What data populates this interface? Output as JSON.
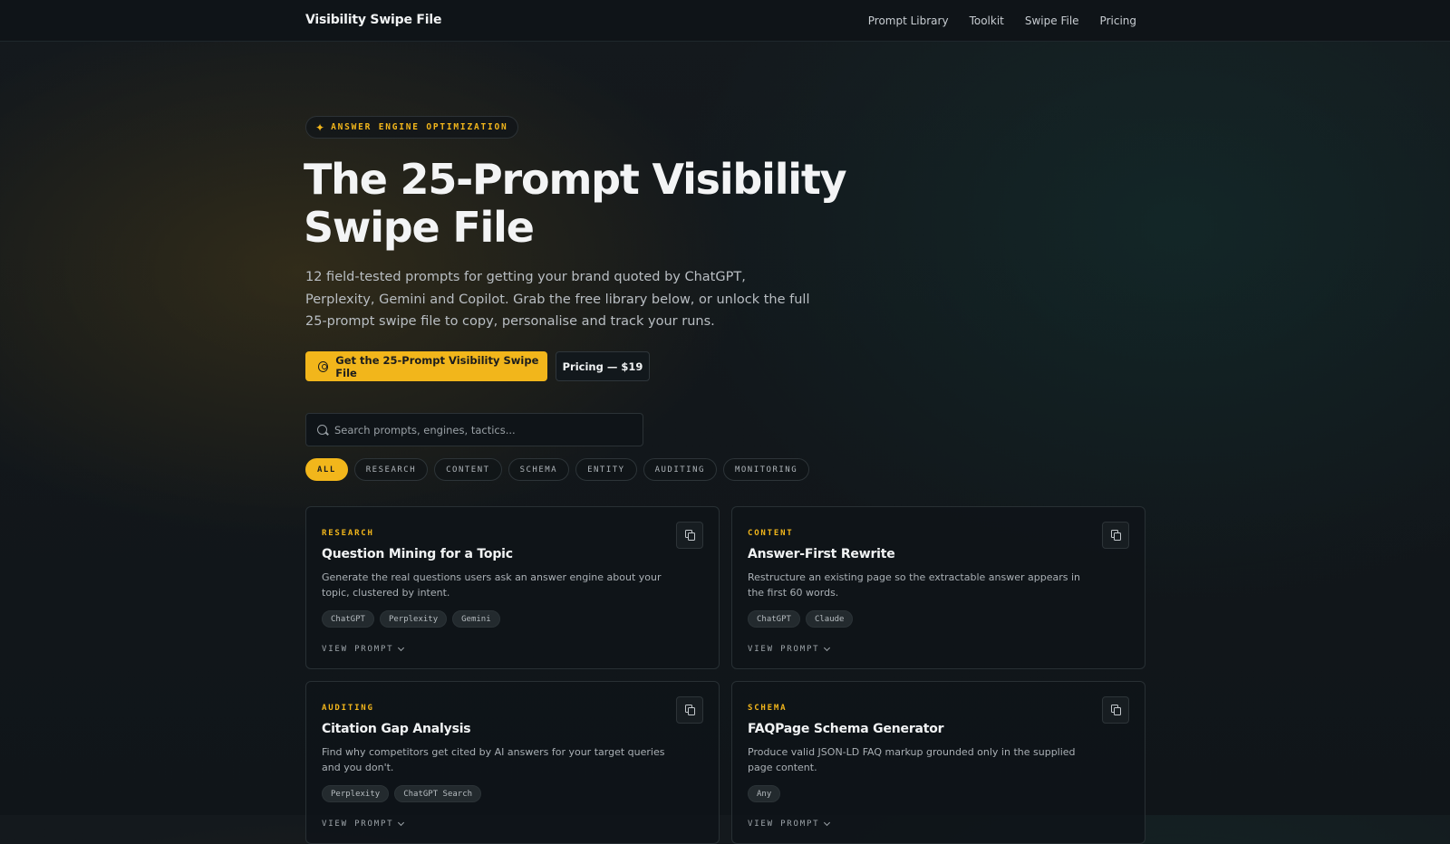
{
  "nav": {
    "brand": "Visibility Swipe File",
    "links": [
      "Prompt Library",
      "Toolkit",
      "Swipe File",
      "Pricing"
    ]
  },
  "hero": {
    "eyebrow": "ANSWER ENGINE OPTIMIZATION",
    "title": "The 25-Prompt Visibility Swipe File",
    "subtitle": "12 field-tested prompts for getting your brand quoted by ChatGPT, Perplexity, Gemini and Copilot. Grab the free library below, or unlock the full 25-prompt swipe file to copy, personalise and track your runs.",
    "primary_button": "Get the 25-Prompt Visibility Swipe File",
    "secondary_button": "Pricing — $19"
  },
  "search": {
    "placeholder": "Search prompts, engines, tactics..."
  },
  "filters": {
    "active": "ALL",
    "items": [
      "ALL",
      "RESEARCH",
      "CONTENT",
      "SCHEMA",
      "ENTITY",
      "AUDITING",
      "MONITORING"
    ]
  },
  "cards": [
    {
      "category": "RESEARCH",
      "title": "Question Mining for a Topic",
      "description": "Generate the real questions users ask an answer engine about your topic, clustered by intent.",
      "tags": [
        "ChatGPT",
        "Perplexity",
        "Gemini"
      ],
      "action": "VIEW PROMPT"
    },
    {
      "category": "CONTENT",
      "title": "Answer-First Rewrite",
      "description": "Restructure an existing page so the extractable answer appears in the first 60 words.",
      "tags": [
        "ChatGPT",
        "Claude"
      ],
      "action": "VIEW PROMPT"
    },
    {
      "category": "AUDITING",
      "title": "Citation Gap Analysis",
      "description": "Find why competitors get cited by AI answers for your target queries and you don't.",
      "tags": [
        "Perplexity",
        "ChatGPT Search"
      ],
      "action": "VIEW PROMPT"
    },
    {
      "category": "SCHEMA",
      "title": "FAQPage Schema Generator",
      "description": "Produce valid JSON-LD FAQ markup grounded only in the supplied page content.",
      "tags": [
        "Any"
      ],
      "action": "VIEW PROMPT"
    }
  ],
  "colors": {
    "accent": "#f2b61b",
    "background": "#12171b",
    "card": "#0f1418"
  },
  "icons": [
    "sparkle-icon",
    "target-icon",
    "search-icon",
    "copy-icon",
    "chevron-down-icon"
  ]
}
